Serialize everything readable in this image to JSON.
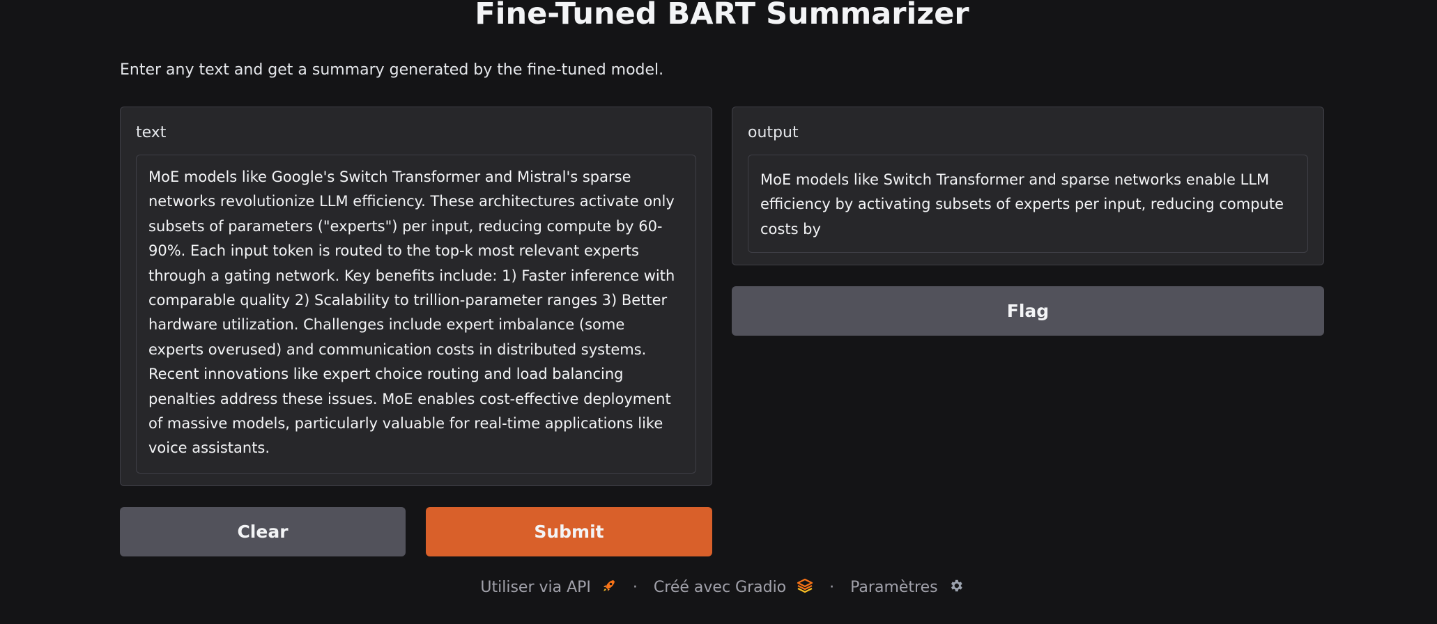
{
  "header": {
    "title": "Fine-Tuned BART Summarizer",
    "description": "Enter any text and get a summary generated by the fine-tuned model."
  },
  "input_panel": {
    "label": "text",
    "value": "MoE models like Google's Switch Transformer and Mistral's sparse networks revolutionize LLM efficiency. These architectures activate only subsets of parameters (\"experts\") per input, reducing compute by 60-90%. Each input token is routed to the top-k most relevant experts through a gating network. Key benefits include: 1) Faster inference with comparable quality 2) Scalability to trillion-parameter ranges 3) Better hardware utilization. Challenges include expert imbalance (some experts overused) and communication costs in distributed systems. Recent innovations like expert choice routing and load balancing penalties address these issues. MoE enables cost-effective deployment of massive models, particularly valuable for real-time applications like voice assistants."
  },
  "output_panel": {
    "label": "output",
    "value": "MoE models like Switch Transformer and sparse networks enable LLM efficiency by activating subsets of experts per input, reducing compute costs by"
  },
  "buttons": {
    "clear": "Clear",
    "submit": "Submit",
    "flag": "Flag"
  },
  "footer": {
    "api": "Utiliser via API",
    "built_with": "Créé avec Gradio",
    "settings": "Paramètres",
    "separator": "·"
  },
  "icons": {
    "api": "rocket-icon",
    "gradio": "gradio-logo-icon",
    "settings": "gear-icon"
  },
  "colors": {
    "background": "#141416",
    "panel": "#27272a",
    "primary": "#d9602a",
    "secondary": "#52525b"
  }
}
